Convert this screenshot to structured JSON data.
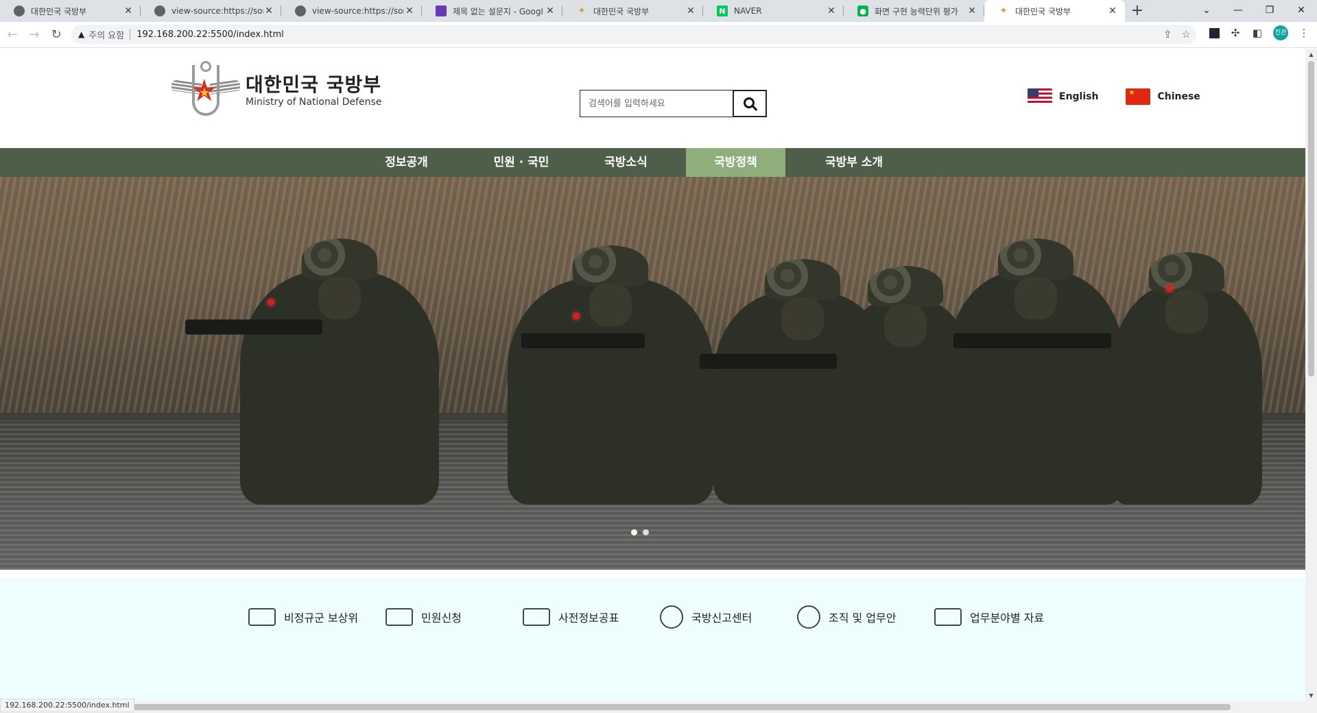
{
  "browser": {
    "tabs": [
      {
        "title": "대한민국 국방부",
        "icon": "globe-icon"
      },
      {
        "title": "view-source:https://sonjin",
        "icon": "globe-icon"
      },
      {
        "title": "view-source:https://sonjin",
        "icon": "globe-icon"
      },
      {
        "title": "제목 없는 설문지 - Googl",
        "icon": "forms-icon"
      },
      {
        "title": "대한민국 국방부",
        "icon": "mnd-icon"
      },
      {
        "title": "NAVER",
        "icon": "naver-icon"
      },
      {
        "title": "화면 구현 능력단위 평가",
        "icon": "green-icon"
      },
      {
        "title": "대한민국 국방부",
        "icon": "mnd-icon"
      }
    ],
    "active_tab_index": 7,
    "security_label": "주의 요함",
    "url": "192.168.200.22:5500/index.html",
    "profile_label": "진관",
    "status_url": "192.168.200.22:5500/index.html"
  },
  "site": {
    "logo_ko": "대한민국 국방부",
    "logo_en": "Ministry of National Defense",
    "search_placeholder": "검색어를 입력하세요",
    "languages": [
      {
        "label": "English",
        "flag": "us-flag-icon"
      },
      {
        "label": "Chinese",
        "flag": "cn-flag-icon"
      }
    ],
    "nav": [
      {
        "label": "정보공개",
        "active": false
      },
      {
        "label": "민원 · 국민",
        "active": false
      },
      {
        "label": "국방소식",
        "active": false
      },
      {
        "label": "국방정책",
        "active": true
      },
      {
        "label": "국방부 소개",
        "active": false
      }
    ],
    "slider": {
      "count": 2,
      "current": 0
    },
    "quick_links": [
      {
        "label": "비정규군 보상위",
        "icon": "veteran-icon"
      },
      {
        "label": "민원신청",
        "icon": "clipboard-icon"
      },
      {
        "label": "사전정보공표",
        "icon": "document-search-icon"
      },
      {
        "label": "국방신고센터",
        "icon": "phone-icon"
      },
      {
        "label": "조직 및 업무안",
        "icon": "organization-icon"
      },
      {
        "label": "업무분야별 자료",
        "icon": "books-icon"
      }
    ]
  },
  "colors": {
    "nav_bg": "#4e5e48",
    "nav_active": "#8fae7c",
    "quick_bg": "#eefdfd"
  }
}
